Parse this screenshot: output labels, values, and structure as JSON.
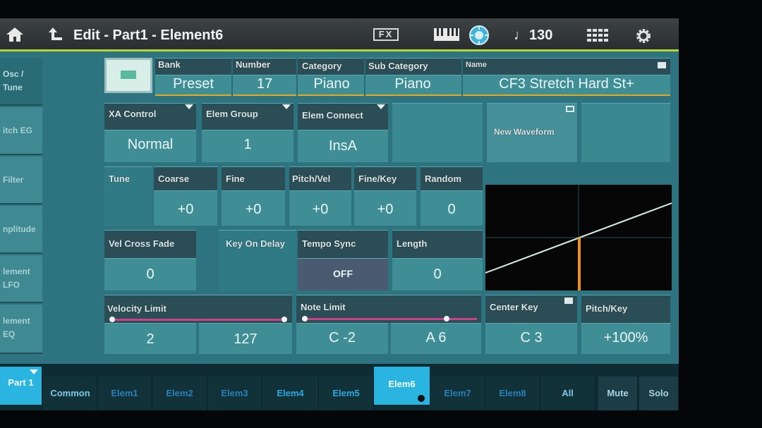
{
  "header": {
    "title": "Edit - Part1 - Element6",
    "fx_label": "FX",
    "tempo": "130",
    "home_icon": "home-icon",
    "up_icon": "up-arrow-icon"
  },
  "sidebar": {
    "items": [
      {
        "line1": "Osc /",
        "line2": "Tune"
      },
      {
        "line1": "itch EG",
        "line2": ""
      },
      {
        "line1": "Filter",
        "line2": ""
      },
      {
        "line1": "nplitude",
        "line2": ""
      },
      {
        "line1": "lement",
        "line2": "LFO"
      },
      {
        "line1": "lement",
        "line2": "EQ"
      }
    ]
  },
  "waveform": {
    "bank_label": "Bank",
    "bank_value": "Preset",
    "number_label": "Number",
    "number_value": "17",
    "category_label": "Category",
    "category_value": "Piano",
    "subcategory_label": "Sub Category",
    "subcategory_value": "Piano",
    "name_label": "Name",
    "name_value": "CF3 Stretch Hard St+"
  },
  "row2": {
    "xa_label": "XA Control",
    "xa_value": "Normal",
    "group_label": "Elem Group",
    "group_value": "1",
    "connect_label": "Elem Connect",
    "connect_value": "InsA",
    "new_waveform_label": "New Waveform"
  },
  "tune": {
    "tune_label": "Tune",
    "coarse_label": "Coarse",
    "coarse_value": "+0",
    "fine_label": "Fine",
    "fine_value": "+0",
    "pitchvel_label": "Pitch/Vel",
    "pitchvel_value": "+0",
    "finekey_label": "Fine/Key",
    "finekey_value": "+0",
    "random_label": "Random",
    "random_value": "0"
  },
  "row4": {
    "velcross_label": "Vel Cross Fade",
    "velcross_value": "0",
    "keyondelay_label": "Key On Delay",
    "temposync_label": "Tempo Sync",
    "temposync_value": "OFF",
    "length_label": "Length",
    "length_value": "0"
  },
  "limits": {
    "velocity_label": "Velocity Limit",
    "velocity_low": "2",
    "velocity_high": "127",
    "note_label": "Note Limit",
    "note_low": "C -2",
    "note_high": "A 6",
    "centerkey_label": "Center Key",
    "centerkey_value": "C 3",
    "pitchkey_label": "Pitch/Key",
    "pitchkey_value": "+100%"
  },
  "tabs": {
    "part": "Part 1",
    "items": [
      "Common",
      "Elem1",
      "Elem2",
      "Elem3",
      "Elem4",
      "Elem5",
      "Elem6",
      "Elem7",
      "Elem8",
      "All"
    ],
    "mute": "Mute",
    "solo": "Solo"
  },
  "colors": {
    "accent": "#b6d334",
    "graph_line": "#cfeee0",
    "graph_marker": "#f0901a",
    "selected_tab": "#2ab4e0"
  }
}
